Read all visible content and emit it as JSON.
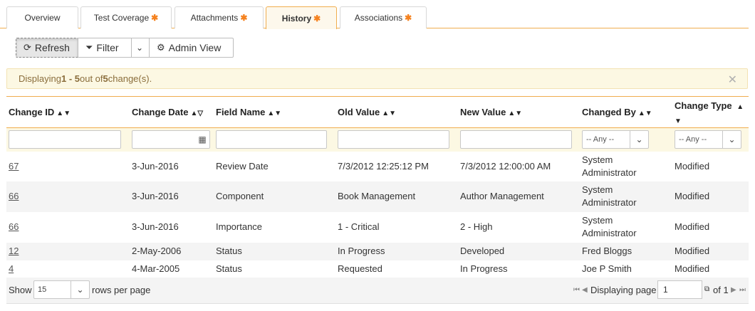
{
  "tabs": [
    {
      "label": "Overview",
      "starred": false
    },
    {
      "label": "Test Coverage",
      "starred": true
    },
    {
      "label": "Attachments",
      "starred": true
    },
    {
      "label": "History",
      "starred": true,
      "active": true
    },
    {
      "label": "Associations",
      "starred": true
    }
  ],
  "toolbar": {
    "refresh_label": "Refresh",
    "filter_label": "Filter",
    "admin_view_label": "Admin View"
  },
  "alert": {
    "prefix": "Displaying ",
    "range": "1 - 5",
    "middle": " out of ",
    "total": "5",
    "suffix": " change(s)."
  },
  "columns": [
    {
      "label": "Change ID",
      "sort": "▲▼"
    },
    {
      "label": "Change Date",
      "sort": "▲▽"
    },
    {
      "label": "Field Name",
      "sort": "▲▼"
    },
    {
      "label": "Old Value",
      "sort": "▲▼"
    },
    {
      "label": "New Value",
      "sort": "▲▼"
    },
    {
      "label": "Changed By",
      "sort": "▲▼"
    },
    {
      "label": "Change Type",
      "sort_up": "▲",
      "sort_down": "▼"
    }
  ],
  "filters": {
    "changed_by_select": "-- Any --",
    "change_type_select": "-- Any --"
  },
  "rows": [
    {
      "id": "67",
      "date": "3-Jun-2016",
      "field": "Review Date",
      "old": "7/3/2012 12:25:12 PM",
      "new": "7/3/2012 12:00:00 AM",
      "by_line1": "System",
      "by_line2": "Administrator",
      "type": "Modified"
    },
    {
      "id": "66",
      "date": "3-Jun-2016",
      "field": "Component",
      "old": "Book Management",
      "new": "Author Management",
      "by_line1": "System",
      "by_line2": "Administrator",
      "type": "Modified"
    },
    {
      "id": "66",
      "date": "3-Jun-2016",
      "field": "Importance",
      "old": "1 - Critical",
      "new": "2 - High",
      "by_line1": "System",
      "by_line2": "Administrator",
      "type": "Modified"
    },
    {
      "id": "12",
      "date": "2-May-2006",
      "field": "Status",
      "old": "In Progress",
      "new": "Developed",
      "by_line1": "Fred Bloggs",
      "by_line2": "",
      "type": "Modified"
    },
    {
      "id": "4",
      "date": "4-Mar-2005",
      "field": "Status",
      "old": "Requested",
      "new": "In Progress",
      "by_line1": "Joe P Smith",
      "by_line2": "",
      "type": "Modified"
    }
  ],
  "footer": {
    "show_label": "Show",
    "rows_value": "15",
    "rows_per_page_label": "rows per page",
    "displaying_page_label": "Displaying page",
    "page_value": "1",
    "of_label": "of 1"
  },
  "colors": {
    "accent": "#f0ad4e",
    "star": "#f5821f",
    "alert_bg": "#fcf8e3",
    "alert_text": "#8a6d3b",
    "row_alt": "#f4f4f4"
  }
}
